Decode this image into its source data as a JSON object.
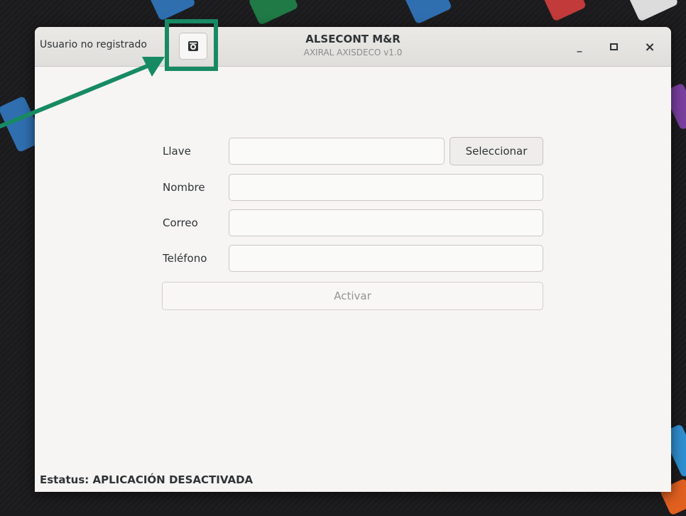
{
  "window": {
    "title": "ALSECONT M&R",
    "subtitle": "AXIRAL AXISDECO v1.0",
    "user_status": "Usuario no registrado",
    "controls": {
      "minimize": "_",
      "maximize": "▫",
      "close": "×"
    }
  },
  "form": {
    "key_label": "Llave",
    "key_value": "",
    "select_button": "Seleccionar",
    "name_label": "Nombre",
    "name_value": "",
    "email_label": "Correo",
    "email_value": "",
    "phone_label": "Teléfono",
    "phone_value": "",
    "activate_button": "Activar"
  },
  "status": "Estatus: APLICACIÓN DESACTIVADA",
  "icons": {
    "info_button": "about-dialog-icon",
    "annotation": "arrow-annotation"
  },
  "colors": {
    "annotation": "#178a64",
    "window_bg": "#f6f5f4",
    "headerbar_bg": "#e8e6e3"
  }
}
